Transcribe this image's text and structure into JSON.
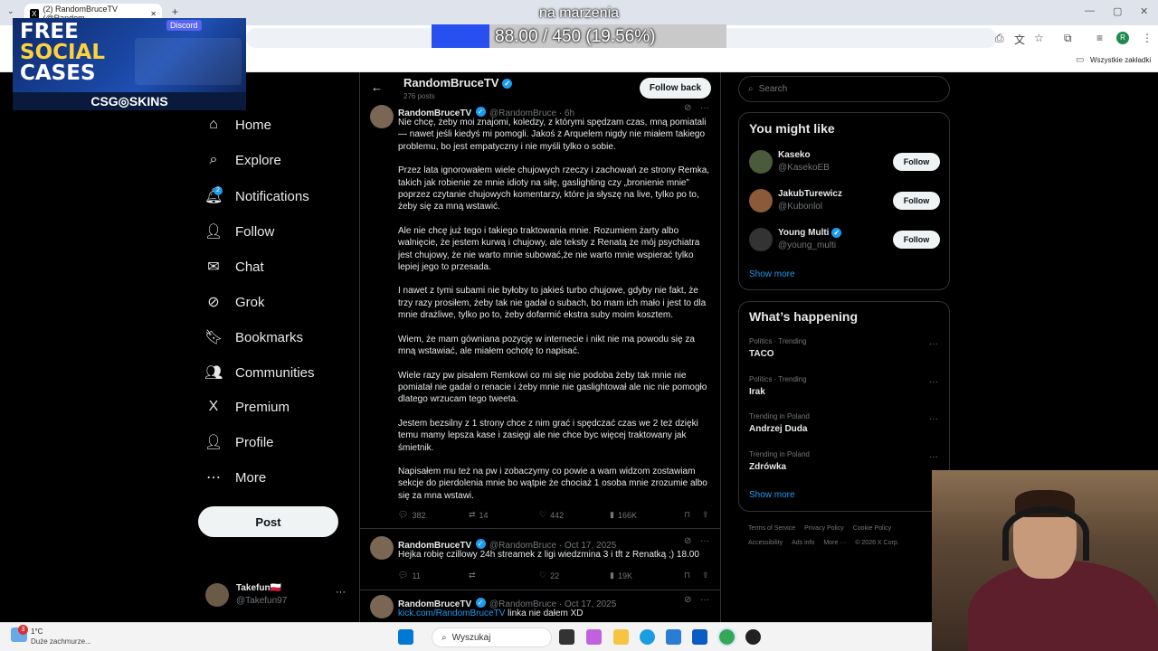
{
  "browser": {
    "tab_title": "(2) RandomBruceTV (@Random",
    "tab_close": "✕",
    "new_tab": "+",
    "bookmarks_label": "Wszystkie zakładki",
    "profile_initial": "R"
  },
  "overlay": {
    "promo": {
      "line1": "FREE",
      "line2": "SOCIAL",
      "line3": "CASES",
      "brand": "CSG◎SKINS",
      "tag": "Discord"
    },
    "goal": {
      "label": "na marzenia",
      "current": 88.0,
      "target": 450,
      "progress": 0.1956,
      "value_text": "88.00 / 450 (19.56%)"
    }
  },
  "nav": {
    "items": [
      {
        "label": "Home",
        "icon": "⌂"
      },
      {
        "label": "Explore",
        "icon": "⌕"
      },
      {
        "label": "Notifications",
        "icon": "🔔︎"
      },
      {
        "label": "Follow",
        "icon": "👤︎"
      },
      {
        "label": "Chat",
        "icon": "✉"
      },
      {
        "label": "Grok",
        "icon": "⊘"
      },
      {
        "label": "Bookmarks",
        "icon": "🔖︎"
      },
      {
        "label": "Communities",
        "icon": "👥︎"
      },
      {
        "label": "Premium",
        "icon": "X"
      },
      {
        "label": "Profile",
        "icon": "👤︎"
      },
      {
        "label": "More",
        "icon": "⋯"
      }
    ],
    "notif_count": "2",
    "post_label": "Post",
    "me": {
      "name": "Takefun🇵🇱",
      "handle": "@Takefun97"
    }
  },
  "profile": {
    "name": "RandomBruceTV",
    "posts": "276 posts",
    "follow_back": "Follow back",
    "back": "←"
  },
  "tweets": [
    {
      "name": "RandomBruceTV",
      "handle": "@RandomBruce · 6h",
      "paragraphs": [
        "Nie chcę, żeby moi znajomi, koledzy, z którymi spędzam czas, mną pomiatali — nawet jeśli kiedyś mi pomogli. Jakoś z Arquelem nigdy nie miałem takiego problemu, bo jest empatyczny i nie myśli tylko o sobie.",
        "Przez lata ignorowałem wiele chujowych rzeczy i zachowań ze strony Remka, takich jak robienie ze mnie idioty na siłę, gaslighting czy „bronienie mnie” poprzez czytanie chujowych komentarzy, które ja słyszę na live, tylko po to, żeby się za mną wstawić.",
        "Ale nie chcę już tego i takiego traktowania mnie. Rozumiem żarty albo walnięcie, że jestem kurwą i chujowy, ale teksty z Renatą  że mój psychiatra jest chujowy, że nie warto mnie subować,że nie warto mnie wspierać tylko lepiej jego  to przesada.",
        "I nawet z tymi subami nie byłoby to jakieś turbo chujowe, gdyby nie fakt, że trzy razy prosiłem, żeby tak nie gadał o subach, bo mam ich mało i jest to dla mnie drażliwe, tylko po to, żeby dofarmić ekstra suby moim kosztem.",
        "Wiem, że mam gówniana pozycję w internecie i nikt nie ma powodu się za mną wstawiać, ale miałem ochotę to napisać.",
        "Wiele razy pw pisałem Remkowi co mi się nie podoba żeby tak mnie nie pomiatał nie gadał o renacie i żeby mnie nie gaslightował ale nic nie pomogło dlatego wrzucam tego tweeta.",
        "Jestem bezsilny z 1 strony chce z nim grać i spędczać czas we 2 też dzięki temu mamy lepsza kase i zasięgi ale nie chce byc więcej traktowany jak śmietnik.",
        "Napisałem mu też na pw i zobaczymy co powie a wam widzom zostawiam sekcje do pierdolenia mnie bo wątpie że chociaż 1 osoba mnie zrozumie albo się za mna wstawi."
      ],
      "replies": "382",
      "reposts": "14",
      "likes": "442",
      "views": "166K"
    },
    {
      "name": "RandomBruceTV",
      "handle": "@RandomBruce · Oct 17, 2025",
      "text": "Hejka robię czillowy 24h streamek z ligi wiedzmina 3 i tft z Renatką ;) 18.00",
      "replies": "11",
      "reposts": "",
      "likes": "22",
      "views": "19K"
    },
    {
      "name": "RandomBruceTV",
      "handle": "@RandomBruce · Oct 17, 2025",
      "link": "kick.com/RandomBruceTV",
      "text": " linka nie dałem XD"
    }
  ],
  "sidebar": {
    "search_placeholder": "Search",
    "might_like_title": "You might like",
    "suggestions": [
      {
        "name": "Kaseko",
        "handle": "@KasekoEB",
        "verified": false,
        "button": "Follow"
      },
      {
        "name": "JakubTurewicz",
        "handle": "@Kubonlol",
        "verified": false,
        "button": "Follow"
      },
      {
        "name": "Young Multi",
        "handle": "@young_multi",
        "verified": true,
        "button": "Follow"
      }
    ],
    "show_more": "Show more",
    "happening_title": "What’s happening",
    "trends": [
      {
        "meta": "Politics · Trending",
        "title": "TACO"
      },
      {
        "meta": "Politics · Trending",
        "title": "Irak"
      },
      {
        "meta": "Trending in Poland",
        "title": "Andrzej Duda"
      },
      {
        "meta": "Trending in Poland",
        "title": "Zdrówka"
      }
    ],
    "footer": [
      "Terms of Service",
      "Privacy Policy",
      "Cookie Policy",
      "Accessibility",
      "Ads info",
      "More ···",
      "© 2026 X Corp."
    ]
  },
  "taskbar": {
    "weather_temp": "1°C",
    "weather_desc": "Duże zachmurze...",
    "weather_badge": "3",
    "search": "Wyszukaj"
  },
  "colors": {
    "accent": "#1d9bf0",
    "background": "#000000",
    "goal_fill": "#2850f0",
    "hoodie": "#5d1f2b"
  }
}
